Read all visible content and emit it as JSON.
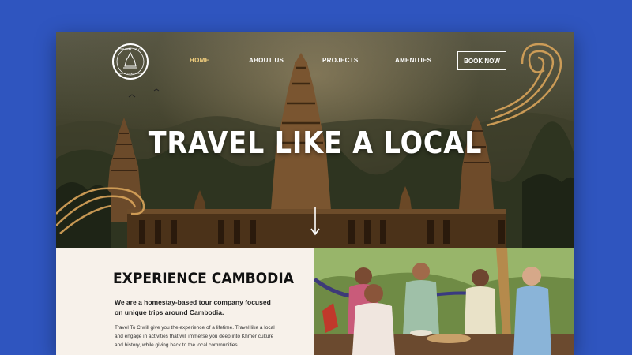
{
  "brand": {
    "logo_text": "TRAVEL TO C",
    "logo_sub": "TRAVEL LIKE A LOCAL"
  },
  "nav": {
    "items": [
      {
        "label": "HOME",
        "active": true
      },
      {
        "label": "ABOUT US",
        "active": false
      },
      {
        "label": "PROJECTS",
        "active": false
      },
      {
        "label": "AMENITIES",
        "active": false
      }
    ],
    "cta": "BOOK NOW"
  },
  "hero": {
    "title": "TRAVEL LIKE A LOCAL",
    "scroll_icon": "arrow-down-icon"
  },
  "section": {
    "title": "EXPERIENCE CAMBODIA",
    "intro": "We are a homestay-based tour company focused on unique trips around Cambodia.",
    "body": "Travel To C will give you the experience of a lifetime. Travel like a local and engage in activities that will immerse you deep into Khmer culture and history, while giving back to the local communities."
  },
  "colors": {
    "background": "#2f55bf",
    "nav_active": "#f3d07f",
    "section_bg": "#f7f1ea",
    "swirl": "#d9a45a"
  }
}
